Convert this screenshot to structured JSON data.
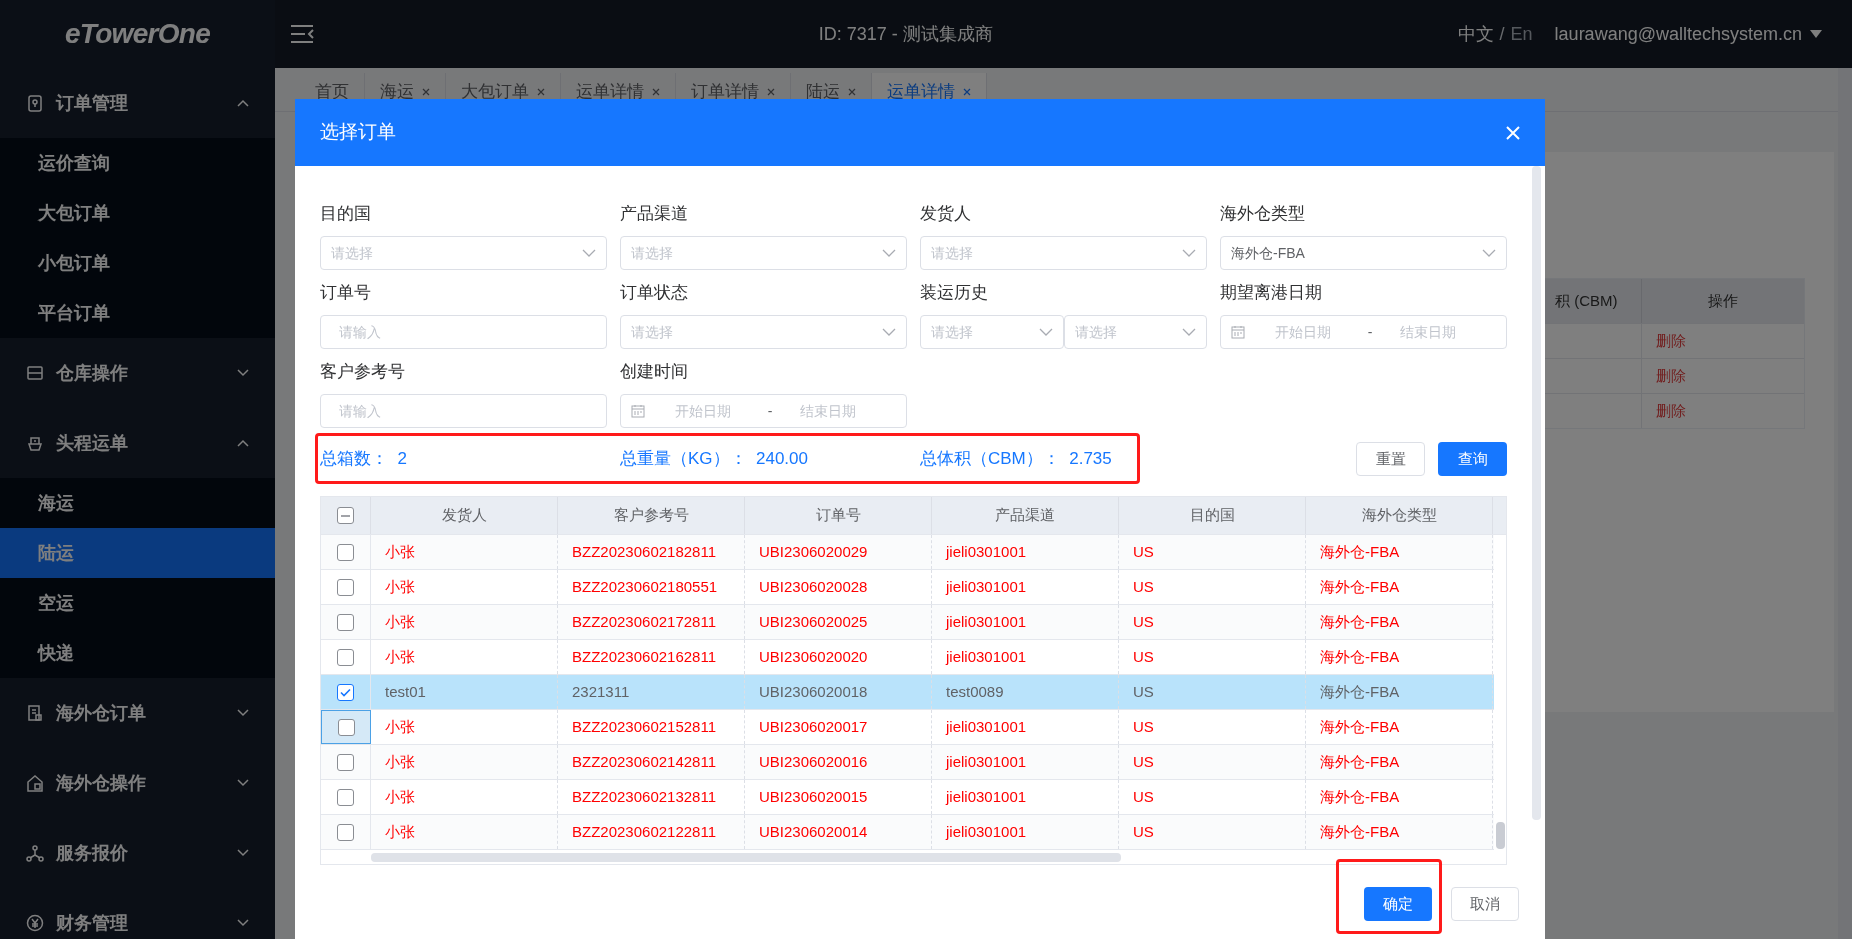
{
  "topbar": {
    "logo": "eTowerOne",
    "account": "ID: 7317 - 测试集成商",
    "languages": [
      {
        "label": "中文",
        "selected": true
      },
      {
        "label": "En",
        "selected": false
      }
    ],
    "language_separator": "/",
    "user_email": "laurawang@walltechsystem.cn"
  },
  "sidebar": {
    "groups": [
      {
        "label": "订单管理",
        "expanded": true,
        "children": [
          {
            "label": "运价查询",
            "selected": false
          },
          {
            "label": "大包订单",
            "selected": false
          },
          {
            "label": "小包订单",
            "selected": false
          },
          {
            "label": "平台订单",
            "selected": false
          }
        ]
      },
      {
        "label": "仓库操作",
        "expanded": false
      },
      {
        "label": "头程运单",
        "expanded": true,
        "children": [
          {
            "label": "海运",
            "selected": false
          },
          {
            "label": "陆运",
            "selected": true
          },
          {
            "label": "空运",
            "selected": false
          },
          {
            "label": "快递",
            "selected": false
          }
        ]
      },
      {
        "label": "海外仓订单",
        "expanded": false
      },
      {
        "label": "海外仓操作",
        "expanded": false
      },
      {
        "label": "服务报价",
        "expanded": false
      },
      {
        "label": "财务管理",
        "expanded": false
      }
    ]
  },
  "tabs": [
    {
      "label": "首页",
      "closable": false,
      "selected": false
    },
    {
      "label": "海运",
      "closable": true,
      "selected": false
    },
    {
      "label": "大包订单",
      "closable": true,
      "selected": false
    },
    {
      "label": "运单详情",
      "closable": true,
      "selected": false
    },
    {
      "label": "订单详情",
      "closable": true,
      "selected": false
    },
    {
      "label": "陆运",
      "closable": true,
      "selected": false
    },
    {
      "label": "运单详情",
      "closable": true,
      "selected": true
    }
  ],
  "background_table": {
    "columns": [
      "积 (CBM)",
      "操作"
    ],
    "rows": [
      {
        "action": "删除"
      },
      {
        "action": "删除"
      },
      {
        "action": "删除"
      }
    ]
  },
  "modal": {
    "title": "选择订单",
    "fields": [
      {
        "label": "目的国",
        "kind": "select",
        "placeholder": "请选择"
      },
      {
        "label": "产品渠道",
        "kind": "select",
        "placeholder": "请选择"
      },
      {
        "label": "发货人",
        "kind": "select",
        "placeholder": "请选择"
      },
      {
        "label": "海外仓类型",
        "kind": "select",
        "value": "海外仓-FBA"
      },
      {
        "label": "订单号",
        "kind": "input",
        "placeholder": "请输入"
      },
      {
        "label": "订单状态",
        "kind": "select",
        "placeholder": "请选择"
      },
      {
        "label": "装运历史",
        "kind": "select_pair",
        "placeholders": [
          "请选择",
          "请选择"
        ]
      },
      {
        "label": "期望离港日期",
        "kind": "date_range",
        "start_placeholder": "开始日期",
        "separator": "-",
        "end_placeholder": "结束日期"
      },
      {
        "label": "客户参考号",
        "kind": "input",
        "placeholder": "请输入"
      },
      {
        "label": "创建时间",
        "kind": "date_range",
        "start_placeholder": "开始日期",
        "separator": "-",
        "end_placeholder": "结束日期"
      }
    ],
    "summary": [
      "总箱数：  2",
      "总重量（KG）：  240.00",
      "总体积（CBM）：  2.735"
    ],
    "buttons": [
      {
        "label": "重置",
        "kind": "default"
      },
      {
        "label": "查询",
        "kind": "primary"
      }
    ],
    "table": {
      "header_checkbox": {
        "indeterminate": true
      },
      "columns": [
        "发货人",
        "客户参考号",
        "订单号",
        "产品渠道",
        "目的国",
        "海外仓类型"
      ],
      "rows": [
        {
          "checked": false,
          "focused": false,
          "color": "#ff0000",
          "cells": [
            "小张",
            "BZZ20230602182811",
            "UBI2306020029",
            "jieli0301001",
            "US",
            "海外仓-FBA"
          ]
        },
        {
          "checked": false,
          "focused": false,
          "color": "#ff0000",
          "cells": [
            "小张",
            "BZZ20230602180551",
            "UBI2306020028",
            "jieli0301001",
            "US",
            "海外仓-FBA"
          ]
        },
        {
          "checked": false,
          "focused": false,
          "color": "#ff0000",
          "cells": [
            "小张",
            "BZZ20230602172811",
            "UBI2306020025",
            "jieli0301001",
            "US",
            "海外仓-FBA"
          ]
        },
        {
          "checked": false,
          "focused": false,
          "color": "#ff0000",
          "cells": [
            "小张",
            "BZZ20230602162811",
            "UBI2306020020",
            "jieli0301001",
            "US",
            "海外仓-FBA"
          ]
        },
        {
          "checked": true,
          "focused": false,
          "color": "#606266",
          "cells": [
            "test01",
            "2321311",
            "UBI2306020018",
            "test0089",
            "US",
            "海外仓-FBA"
          ]
        },
        {
          "checked": false,
          "focused": true,
          "color": "#ff0000",
          "cells": [
            "小张",
            "BZZ20230602152811",
            "UBI2306020017",
            "jieli0301001",
            "US",
            "海外仓-FBA"
          ]
        },
        {
          "checked": false,
          "focused": false,
          "color": "#ff0000",
          "cells": [
            "小张",
            "BZZ20230602142811",
            "UBI2306020016",
            "jieli0301001",
            "US",
            "海外仓-FBA"
          ]
        },
        {
          "checked": false,
          "focused": false,
          "color": "#ff0000",
          "cells": [
            "小张",
            "BZZ20230602132811",
            "UBI2306020015",
            "jieli0301001",
            "US",
            "海外仓-FBA"
          ]
        },
        {
          "checked": false,
          "focused": false,
          "color": "#ff0000",
          "cells": [
            "小张",
            "BZZ20230602122811",
            "UBI2306020014",
            "jieli0301001",
            "US",
            "海外仓-FBA"
          ]
        }
      ]
    },
    "footer_buttons": [
      {
        "label": "确定",
        "kind": "primary"
      },
      {
        "label": "取消",
        "kind": "default"
      }
    ]
  }
}
